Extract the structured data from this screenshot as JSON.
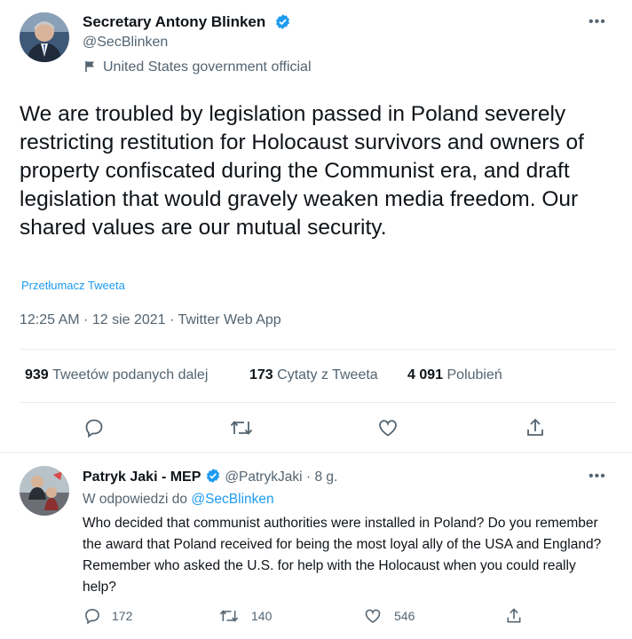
{
  "tweet": {
    "author_name": "Secretary Antony Blinken",
    "author_handle": "@SecBlinken",
    "gov_label": "United States government official",
    "text": "We are troubled by legislation passed in Poland severely restricting restitution for Holocaust survivors and owners of property confiscated during the Communist era, and draft legislation that would gravely weaken media freedom. Our shared values are our mutual security.",
    "translate_link": "Przetłumacz Tweeta",
    "meta": "12:25 AM · 12 sie 2021 · Twitter Web App",
    "stats": {
      "retweets_num": "939",
      "retweets_lbl": "Tweetów podanych dalej",
      "quotes_num": "173",
      "quotes_lbl": "Cytaty z Tweeta",
      "likes_num": "4 091",
      "likes_lbl": "Polubień"
    }
  },
  "reply": {
    "author_name": "Patryk Jaki - MEP",
    "author_handle": "@PatrykJaki",
    "time": "· 8 g.",
    "replying_prefix": "W odpowiedzi do",
    "replying_to": "@SecBlinken",
    "text": "Who decided that communist authorities were installed in Poland? Do you remember the award that Poland received for being the most loyal ally of the USA and England? Remember who asked the U.S. for help with the Holocaust when you could really help?",
    "counts": {
      "replies": "172",
      "retweets": "140",
      "likes": "546"
    }
  },
  "icons": [
    "more-icon",
    "verified-icon",
    "flag-icon",
    "reply-icon",
    "retweet-icon",
    "like-icon",
    "share-icon"
  ],
  "colors": {
    "accent": "#1d9bf0",
    "text": "#0f1419",
    "secondary": "#536471",
    "divider": "#e6ecf0"
  }
}
